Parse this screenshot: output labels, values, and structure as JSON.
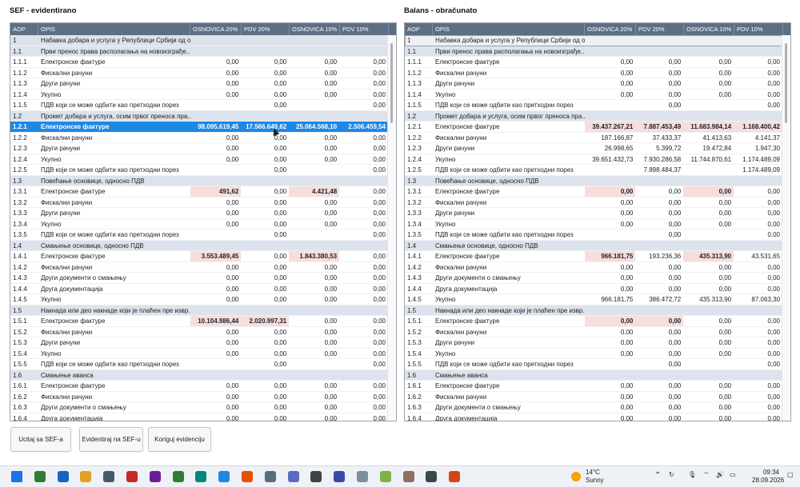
{
  "left": {
    "title": "SEF - evidentirano",
    "columns": [
      "AOP",
      "OPIS",
      "OSNOVICA 20%",
      "PDV 20%",
      "OSNOVICA 10%",
      "PDV 10%"
    ],
    "rows": [
      {
        "aop": "1",
        "opis": "Набавка добара и услуга у Републици Србији од о...",
        "o20": "",
        "p20": "",
        "o10": "",
        "p10": "",
        "type": "sec"
      },
      {
        "aop": "1.1",
        "opis": "Први пренос права располагања на новоизграђе...",
        "o20": "",
        "p20": "",
        "o10": "",
        "p10": "",
        "type": "sec"
      },
      {
        "aop": "1.1.1",
        "opis": "Електронске фактуре",
        "o20": "0,00",
        "p20": "0,00",
        "o10": "0,00",
        "p10": "0,00"
      },
      {
        "aop": "1.1.2",
        "opis": "Фискални рачуни",
        "o20": "0,00",
        "p20": "0,00",
        "o10": "0,00",
        "p10": "0,00"
      },
      {
        "aop": "1.1.3",
        "opis": "Други рачуни",
        "o20": "0,00",
        "p20": "0,00",
        "o10": "0,00",
        "p10": "0,00"
      },
      {
        "aop": "1.1.4",
        "opis": "Укупно",
        "o20": "0,00",
        "p20": "0,00",
        "o10": "0,00",
        "p10": "0,00"
      },
      {
        "aop": "1.1.5",
        "opis": "ПДВ који се може одбити као претходни порез",
        "o20": "",
        "p20": "0,00",
        "o10": "",
        "p10": "0,00"
      },
      {
        "aop": "1.2",
        "opis": "Промет добара и услуга, осим првог преноса пра...",
        "o20": "",
        "p20": "",
        "o10": "",
        "p10": "",
        "type": "sec"
      },
      {
        "aop": "1.2.1",
        "opis": "Електронске фактуре",
        "o20": "98.095.619,45",
        "p20": "17.566.649,62",
        "o10": "25.064.568,10",
        "p10": "2.506.459,54",
        "type": "sel"
      },
      {
        "aop": "1.2.2",
        "opis": "Фискални рачуни",
        "o20": "0,00",
        "p20": "0,00",
        "o10": "0,00",
        "p10": "0,00"
      },
      {
        "aop": "1.2.3",
        "opis": "Други рачуни",
        "o20": "0,00",
        "p20": "0,00",
        "o10": "0,00",
        "p10": "0,00"
      },
      {
        "aop": "1.2.4",
        "opis": "Укупно",
        "o20": "0,00",
        "p20": "0,00",
        "o10": "0,00",
        "p10": "0,00"
      },
      {
        "aop": "1.2.5",
        "opis": "ПДВ који се може одбити као претходни порез",
        "o20": "",
        "p20": "0,00",
        "o10": "",
        "p10": "0,00"
      },
      {
        "aop": "1.3",
        "opis": "Повећање основице, односно ПДВ",
        "o20": "",
        "p20": "",
        "o10": "",
        "p10": "",
        "type": "sec"
      },
      {
        "aop": "1.3.1",
        "opis": "Електронске фактуре",
        "o20": "491,62",
        "p20": "0,00",
        "o10": "4.421,48",
        "p10": "0,00",
        "pink": [
          "o20",
          "o10"
        ]
      },
      {
        "aop": "1.3.2",
        "opis": "Фискални рачуни",
        "o20": "0,00",
        "p20": "0,00",
        "o10": "0,00",
        "p10": "0,00"
      },
      {
        "aop": "1.3.3",
        "opis": "Други рачуни",
        "o20": "0,00",
        "p20": "0,00",
        "o10": "0,00",
        "p10": "0,00"
      },
      {
        "aop": "1.3.4",
        "opis": "Укупно",
        "o20": "0,00",
        "p20": "0,00",
        "o10": "0,00",
        "p10": "0,00"
      },
      {
        "aop": "1.3.5",
        "opis": "ПДВ који се може одбити као претходни порез",
        "o20": "",
        "p20": "0,00",
        "o10": "",
        "p10": "0,00"
      },
      {
        "aop": "1.4",
        "opis": "Смањење основице, односно ПДВ",
        "o20": "",
        "p20": "",
        "o10": "",
        "p10": "",
        "type": "sec"
      },
      {
        "aop": "1.4.1",
        "opis": "Електронске фактуре",
        "o20": "3.553.489,45",
        "p20": "0,00",
        "o10": "1.843.380,53",
        "p10": "0,00",
        "pink": [
          "o20",
          "o10"
        ]
      },
      {
        "aop": "1.4.2",
        "opis": "Фискални рачуни",
        "o20": "0,00",
        "p20": "0,00",
        "o10": "0,00",
        "p10": "0,00"
      },
      {
        "aop": "1.4.3",
        "opis": "Други документи о смањењу",
        "o20": "0,00",
        "p20": "0,00",
        "o10": "0,00",
        "p10": "0,00"
      },
      {
        "aop": "1.4.4",
        "opis": "Друга документација",
        "o20": "0,00",
        "p20": "0,00",
        "o10": "0,00",
        "p10": "0,00"
      },
      {
        "aop": "1.4.5",
        "opis": "Укупно",
        "o20": "0,00",
        "p20": "0,00",
        "o10": "0,00",
        "p10": "0,00"
      },
      {
        "aop": "1.5",
        "opis": "Накнада или део накнаде који је плаћен пре извр...",
        "o20": "",
        "p20": "",
        "o10": "",
        "p10": "",
        "type": "sec"
      },
      {
        "aop": "1.5.1",
        "opis": "Електронске фактуре",
        "o20": "10.104.986,44",
        "p20": "2.020.997,31",
        "o10": "0,00",
        "p10": "0,00",
        "pink": [
          "o20",
          "p20"
        ]
      },
      {
        "aop": "1.5.2",
        "opis": "Фискални рачуни",
        "o20": "0,00",
        "p20": "0,00",
        "o10": "0,00",
        "p10": "0,00"
      },
      {
        "aop": "1.5.3",
        "opis": "Други рачуни",
        "o20": "0,00",
        "p20": "0,00",
        "o10": "0,00",
        "p10": "0,00"
      },
      {
        "aop": "1.5.4",
        "opis": "Укупно",
        "o20": "0,00",
        "p20": "0,00",
        "o10": "0,00",
        "p10": "0,00"
      },
      {
        "aop": "1.5.5",
        "opis": "ПДВ који се може одбити као претходни порез",
        "o20": "",
        "p20": "0,00",
        "o10": "",
        "p10": "0,00"
      },
      {
        "aop": "1.6",
        "opis": "Смањење аванса",
        "o20": "",
        "p20": "",
        "o10": "",
        "p10": "",
        "type": "sec"
      },
      {
        "aop": "1.6.1",
        "opis": "Електронске фактуре",
        "o20": "0,00",
        "p20": "0,00",
        "o10": "0,00",
        "p10": "0,00"
      },
      {
        "aop": "1.6.2",
        "opis": "Фискални рачуни",
        "o20": "0,00",
        "p20": "0,00",
        "o10": "0,00",
        "p10": "0,00"
      },
      {
        "aop": "1.6.3",
        "opis": "Други документи о смањењу",
        "o20": "0,00",
        "p20": "0,00",
        "o10": "0,00",
        "p10": "0,00"
      },
      {
        "aop": "1.6.4",
        "opis": "Друга документација",
        "o20": "0,00",
        "p20": "0,00",
        "o10": "0,00",
        "p10": "0,00"
      }
    ]
  },
  "right": {
    "title": "Balans - obračunato",
    "columns": [
      "AOP",
      "OPIS",
      "OSNOVICA 20%",
      "PDV 20%",
      "OSNOVICA 10%",
      "PDV 10%"
    ],
    "rows": [
      {
        "aop": "1",
        "opis": "Набавка добара и услуга у Републици Србији од о...",
        "o20": "",
        "p20": "",
        "o10": "",
        "p10": "",
        "type": "outlined"
      },
      {
        "aop": "1.1",
        "opis": "Први пренос права располагања на новоизграђе...",
        "o20": "",
        "p20": "",
        "o10": "",
        "p10": "",
        "type": "sec"
      },
      {
        "aop": "1.1.1",
        "opis": "Електронске фактуре",
        "o20": "0,00",
        "p20": "0,00",
        "o10": "0,00",
        "p10": "0,00"
      },
      {
        "aop": "1.1.2",
        "opis": "Фискални рачуни",
        "o20": "0,00",
        "p20": "0,00",
        "o10": "0,00",
        "p10": "0,00"
      },
      {
        "aop": "1.1.3",
        "opis": "Други рачуни",
        "o20": "0,00",
        "p20": "0,00",
        "o10": "0,00",
        "p10": "0,00"
      },
      {
        "aop": "1.1.4",
        "opis": "Укупно",
        "o20": "0,00",
        "p20": "0,00",
        "o10": "0,00",
        "p10": "0,00"
      },
      {
        "aop": "1.1.5",
        "opis": "ПДВ који се може одбити као претходни порез",
        "o20": "",
        "p20": "0,00",
        "o10": "",
        "p10": "0,00"
      },
      {
        "aop": "1.2",
        "opis": "Промет добара и услуга, осим првог преноса пра...",
        "o20": "",
        "p20": "",
        "o10": "",
        "p10": "",
        "type": "sec"
      },
      {
        "aop": "1.2.1",
        "opis": "Електронске фактуре",
        "o20": "39.437.267,21",
        "p20": "7.887.453,49",
        "o10": "11.683.984,14",
        "p10": "1.168.400,42",
        "pink": [
          "o20",
          "p20",
          "o10",
          "p10"
        ]
      },
      {
        "aop": "1.2.2",
        "opis": "Фискални рачуни",
        "o20": "187.166,87",
        "p20": "37.433,37",
        "o10": "41.413,63",
        "p10": "4.141,37"
      },
      {
        "aop": "1.2.3",
        "opis": "Други рачуни",
        "o20": "26.998,65",
        "p20": "5.399,72",
        "o10": "19.472,84",
        "p10": "1.947,30"
      },
      {
        "aop": "1.2.4",
        "opis": "Укупно",
        "o20": "39.651.432,73",
        "p20": "7.930.286,58",
        "o10": "11.744.870,61",
        "p10": "1.174.489,09"
      },
      {
        "aop": "1.2.5",
        "opis": "ПДВ који се може одбити као претходни порез",
        "o20": "",
        "p20": "7.898.484,37",
        "o10": "",
        "p10": "1.174.489,09"
      },
      {
        "aop": "1.3",
        "opis": "Повећање основице, односно ПДВ",
        "o20": "",
        "p20": "",
        "o10": "",
        "p10": "",
        "type": "sec"
      },
      {
        "aop": "1.3.1",
        "opis": "Електронске фактуре",
        "o20": "0,00",
        "p20": "0,00",
        "o10": "0,00",
        "p10": "0,00",
        "pink": [
          "o20",
          "o10"
        ]
      },
      {
        "aop": "1.3.2",
        "opis": "Фискални рачуни",
        "o20": "0,00",
        "p20": "0,00",
        "o10": "0,00",
        "p10": "0,00"
      },
      {
        "aop": "1.3.3",
        "opis": "Други рачуни",
        "o20": "0,00",
        "p20": "0,00",
        "o10": "0,00",
        "p10": "0,00"
      },
      {
        "aop": "1.3.4",
        "opis": "Укупно",
        "o20": "0,00",
        "p20": "0,00",
        "o10": "0,00",
        "p10": "0,00"
      },
      {
        "aop": "1.3.5",
        "opis": "ПДВ који се може одбити као претходни порез",
        "o20": "",
        "p20": "0,00",
        "o10": "",
        "p10": "0,00"
      },
      {
        "aop": "1.4",
        "opis": "Смањење основице, односно ПДВ",
        "o20": "",
        "p20": "",
        "o10": "",
        "p10": "",
        "type": "sec"
      },
      {
        "aop": "1.4.1",
        "opis": "Електронске фактуре",
        "o20": "966.181,75",
        "p20": "193.236,36",
        "o10": "435.313,90",
        "p10": "43.531,65",
        "pink": [
          "o20",
          "o10"
        ]
      },
      {
        "aop": "1.4.2",
        "opis": "Фискални рачуни",
        "o20": "0,00",
        "p20": "0,00",
        "o10": "0,00",
        "p10": "0,00"
      },
      {
        "aop": "1.4.3",
        "opis": "Други документи о смањењу",
        "o20": "0,00",
        "p20": "0,00",
        "o10": "0,00",
        "p10": "0,00"
      },
      {
        "aop": "1.4.4",
        "opis": "Друга документација",
        "o20": "0,00",
        "p20": "0,00",
        "o10": "0,00",
        "p10": "0,00"
      },
      {
        "aop": "1.4.5",
        "opis": "Укупно",
        "o20": "966.181,75",
        "p20": "386.472,72",
        "o10": "435.313,90",
        "p10": "87.063,30"
      },
      {
        "aop": "1.5",
        "opis": "Накнада или део накнаде који је плаћен пре извр...",
        "o20": "",
        "p20": "",
        "o10": "",
        "p10": "",
        "type": "sec"
      },
      {
        "aop": "1.5.1",
        "opis": "Електронске фактуре",
        "o20": "0,00",
        "p20": "0,00",
        "o10": "0,00",
        "p10": "0,00",
        "pink": [
          "o20",
          "p20"
        ]
      },
      {
        "aop": "1.5.2",
        "opis": "Фискални рачуни",
        "o20": "0,00",
        "p20": "0,00",
        "o10": "0,00",
        "p10": "0,00"
      },
      {
        "aop": "1.5.3",
        "opis": "Други рачуни",
        "o20": "0,00",
        "p20": "0,00",
        "o10": "0,00",
        "p10": "0,00"
      },
      {
        "aop": "1.5.4",
        "opis": "Укупно",
        "o20": "0,00",
        "p20": "0,00",
        "o10": "0,00",
        "p10": "0,00"
      },
      {
        "aop": "1.5.5",
        "opis": "ПДВ који се може одбити као претходни порез",
        "o20": "",
        "p20": "0,00",
        "o10": "",
        "p10": "0,00"
      },
      {
        "aop": "1.6",
        "opis": "Смањење аванса",
        "o20": "",
        "p20": "",
        "o10": "",
        "p10": "",
        "type": "sec"
      },
      {
        "aop": "1.6.1",
        "opis": "Електронске фактуре",
        "o20": "0,00",
        "p20": "0,00",
        "o10": "0,00",
        "p10": "0,00"
      },
      {
        "aop": "1.6.2",
        "opis": "Фискални рачуни",
        "o20": "0,00",
        "p20": "0,00",
        "o10": "0,00",
        "p10": "0,00"
      },
      {
        "aop": "1.6.3",
        "opis": "Други документи о смањењу",
        "o20": "0,00",
        "p20": "0,00",
        "o10": "0,00",
        "p10": "0,00"
      },
      {
        "aop": "1.6.4",
        "opis": "Друга документација",
        "o20": "0,00",
        "p20": "0,00",
        "o10": "0,00",
        "p10": "0,00"
      }
    ]
  },
  "buttons": {
    "ucitaj": "Ucitaj sa SEF-a",
    "evidentiraj": "Evidentiraj na SEF-u",
    "koriguj": "Koriguj evidenciju"
  },
  "taskbar": {
    "weather_temp": "14°C",
    "weather_desc": "Sunny",
    "time": "09:34",
    "date": "28.09.2026",
    "icons": [
      "windows-start-icon",
      "excel-icon",
      "save-icon",
      "folder-icon",
      "database-icon",
      "presentation-icon",
      "paint-icon",
      "spreadsheet-icon",
      "chat-icon",
      "photos-icon",
      "firefox-icon",
      "tools-icon",
      "teams-icon",
      "settings-icon",
      "notepad-icon",
      "file-icon",
      "android-icon",
      "archive-icon",
      "document-icon",
      "network-icon"
    ],
    "icon_colors": [
      "#1a73e8",
      "#2e7d32",
      "#1565c0",
      "#e0a020",
      "#455a64",
      "#c62828",
      "#6a1b9a",
      "#2e7d32",
      "#00897b",
      "#1e88e5",
      "#e65100",
      "#546e7a",
      "#5c6bc0",
      "#424242",
      "#3949ab",
      "#78909c",
      "#7cb342",
      "#8d6e63",
      "#37474f",
      "#d84315"
    ]
  }
}
